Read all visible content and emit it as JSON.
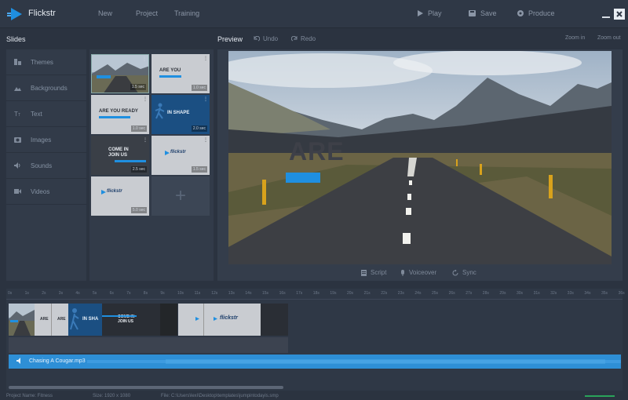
{
  "app": {
    "title": "Flickstr"
  },
  "menu": [
    "New",
    "Project",
    "Training"
  ],
  "actions": {
    "play": "Play",
    "save": "Save",
    "produce": "Produce"
  },
  "slides_panel": {
    "title": "Slides",
    "nav": [
      {
        "label": "Themes",
        "icon": "themes-icon"
      },
      {
        "label": "Backgrounds",
        "icon": "backgrounds-icon"
      },
      {
        "label": "Text",
        "icon": "text-icon"
      },
      {
        "label": "Images",
        "icon": "images-icon"
      },
      {
        "label": "Sounds",
        "icon": "sounds-icon"
      },
      {
        "label": "Videos",
        "icon": "videos-icon"
      }
    ],
    "thumbs": [
      {
        "text": "",
        "duration": "1.5 sec"
      },
      {
        "text": "ARE YOU",
        "duration": "1.0 sec"
      },
      {
        "text": "ARE YOU READY",
        "duration": "1.0 sec"
      },
      {
        "text": "IN SHAPE",
        "duration": "2.0 sec"
      },
      {
        "text": "COME IN JOIN US",
        "duration": "2.5 sec"
      },
      {
        "text": "flickstr",
        "duration": "1.5 sec"
      },
      {
        "text": "flickstr",
        "duration": "5.0 sec"
      }
    ],
    "add_label": "+"
  },
  "preview": {
    "title": "Preview",
    "undo": "Undo",
    "redo": "Redo",
    "zoom_in": "Zoom in",
    "zoom_out": "Zoom out",
    "canvas_text": "ARE",
    "script": "Script",
    "voiceover": "Voiceover",
    "sync": "Sync"
  },
  "timeline": {
    "ticks": [
      "0s",
      "1s",
      "2s",
      "3s",
      "4s",
      "5s",
      "6s",
      "7s",
      "8s",
      "9s",
      "10s",
      "11s",
      "12s",
      "13s",
      "14s",
      "15s",
      "16s",
      "17s",
      "18s",
      "19s",
      "20s",
      "21s",
      "22s",
      "23s",
      "24s",
      "25s",
      "26s",
      "27s",
      "28s",
      "29s",
      "30s",
      "31s",
      "32s",
      "33s",
      "34s",
      "35s",
      "36s"
    ],
    "clips": [
      {
        "text": ""
      },
      {
        "text": "ARE"
      },
      {
        "text": "ARE"
      },
      {
        "text": "IN SHA"
      },
      {
        "text": "COME IN JOIN US"
      },
      {
        "text": "flickstr"
      },
      {
        "text": "flickstr"
      }
    ],
    "audio_label": "Chasing A Cougar.mp3"
  },
  "status": {
    "project_name": "Project Name: Fitness",
    "size": "Size: 1920 x 1080",
    "file": "File: C:\\Users\\lexi\\Desktop\\templates\\jumpintodayis.smp"
  },
  "colors": {
    "accent": "#1f8fe0",
    "bg": "#2b3340"
  }
}
